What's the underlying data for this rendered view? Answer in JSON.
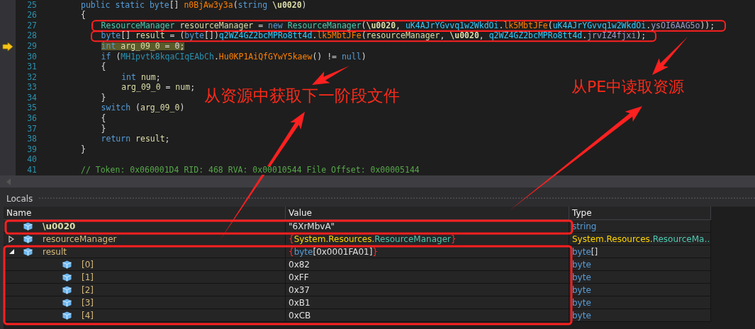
{
  "code_lines": [
    {
      "number": "25",
      "current": false,
      "tokens": [
        {
          "text": "public static byte",
          "kind": "keyword"
        },
        {
          "text": "[] ",
          "kind": "plain"
        },
        {
          "text": "n0BjAw3y3a",
          "kind": "method"
        },
        {
          "text": "(",
          "kind": "plain"
        },
        {
          "text": "string ",
          "kind": "keyword"
        },
        {
          "text": "\\u0020",
          "kind": "param"
        },
        {
          "text": ")",
          "kind": "plain"
        }
      ]
    },
    {
      "number": "26",
      "current": false,
      "tokens": [
        {
          "text": "{",
          "kind": "plain"
        }
      ],
      "children": [
        {
          "number": "27",
          "current": false,
          "tokens": [
            {
              "text": "ResourceManager ",
              "kind": "type"
            },
            {
              "text": "resourceManager",
              "kind": "local"
            },
            {
              "text": " = ",
              "kind": "plain"
            },
            {
              "text": "new ",
              "kind": "keyword"
            },
            {
              "text": "ResourceManager",
              "kind": "type"
            },
            {
              "text": "(",
              "kind": "plain"
            },
            {
              "text": "\\u0020",
              "kind": "param"
            },
            {
              "text": ", ",
              "kind": "plain"
            },
            {
              "text": "uK4AJrYGvvq1w2WkdOi",
              "kind": "class"
            },
            {
              "text": ".",
              "kind": "plain"
            },
            {
              "text": "lk5MbtJFe",
              "kind": "method"
            },
            {
              "text": "(",
              "kind": "plain"
            },
            {
              "text": "uK4AJrYGvvq1w2WkdOi",
              "kind": "class"
            },
            {
              "text": ".",
              "kind": "plain"
            },
            {
              "text": "ysOI6AAG5o",
              "kind": "field"
            },
            {
              "text": "));",
              "kind": "plain"
            }
          ]
        },
        {
          "number": "28",
          "current": false,
          "tokens": [
            {
              "text": "byte",
              "kind": "keyword"
            },
            {
              "text": "[] ",
              "kind": "plain"
            },
            {
              "text": "result",
              "kind": "local"
            },
            {
              "text": " = (",
              "kind": "plain"
            },
            {
              "text": "byte",
              "kind": "keyword"
            },
            {
              "text": "[])",
              "kind": "plain"
            },
            {
              "text": "q2WZ4GZ2bcMPRo8tt4d",
              "kind": "class"
            },
            {
              "text": ".",
              "kind": "plain"
            },
            {
              "text": "lk5MbtJFe",
              "kind": "method"
            },
            {
              "text": "(",
              "kind": "plain"
            },
            {
              "text": "resourceManager",
              "kind": "local"
            },
            {
              "text": ", ",
              "kind": "plain"
            },
            {
              "text": "\\u0020",
              "kind": "param"
            },
            {
              "text": ", ",
              "kind": "plain"
            },
            {
              "text": "q2WZ4GZ2bcMPRo8tt4d",
              "kind": "class"
            },
            {
              "text": ".",
              "kind": "plain"
            },
            {
              "text": "jrvIZ4fjxi",
              "kind": "field"
            },
            {
              "text": ");",
              "kind": "plain"
            }
          ]
        },
        {
          "number": "29",
          "current": true,
          "tokens": [
            {
              "text": "int ",
              "kind": "keyword"
            },
            {
              "text": "arg_09_0",
              "kind": "local"
            },
            {
              "text": " = 0;",
              "kind": "plain"
            }
          ]
        },
        {
          "number": "30",
          "current": false,
          "tokens": [
            {
              "text": "if",
              "kind": "keyword"
            },
            {
              "text": " (",
              "kind": "plain"
            },
            {
              "text": "MH1pvtk8kqaCIqEAbCh",
              "kind": "class2"
            },
            {
              "text": ".",
              "kind": "plain"
            },
            {
              "text": "Hu0KP1AiQfGYwY5kaew",
              "kind": "method"
            },
            {
              "text": "() != ",
              "kind": "plain"
            },
            {
              "text": "null",
              "kind": "keyword"
            },
            {
              "text": ")",
              "kind": "plain"
            }
          ]
        },
        {
          "number": "31",
          "current": false,
          "tokens": [
            {
              "text": "{",
              "kind": "plain"
            }
          ],
          "children": [
            {
              "number": "32",
              "current": false,
              "tokens": [
                {
                  "text": "int ",
                  "kind": "keyword"
                },
                {
                  "text": "num",
                  "kind": "local"
                },
                {
                  "text": ";",
                  "kind": "plain"
                }
              ]
            },
            {
              "number": "33",
              "current": false,
              "tokens": [
                {
                  "text": "arg_09_0",
                  "kind": "local"
                },
                {
                  "text": " = ",
                  "kind": "plain"
                },
                {
                  "text": "num",
                  "kind": "local"
                },
                {
                  "text": ";",
                  "kind": "plain"
                }
              ]
            }
          ]
        },
        {
          "number": "34",
          "current": false,
          "tokens": [
            {
              "text": "}",
              "kind": "plain"
            }
          ]
        },
        {
          "number": "35",
          "current": false,
          "tokens": [
            {
              "text": "switch",
              "kind": "keyword"
            },
            {
              "text": " (",
              "kind": "plain"
            },
            {
              "text": "arg_09_0",
              "kind": "local"
            },
            {
              "text": ")",
              "kind": "plain"
            }
          ]
        },
        {
          "number": "36",
          "current": false,
          "tokens": [
            {
              "text": "{",
              "kind": "plain"
            }
          ]
        },
        {
          "number": "37",
          "current": false,
          "tokens": [
            {
              "text": "}",
              "kind": "plain"
            }
          ]
        },
        {
          "number": "38",
          "current": false,
          "tokens": [
            {
              "text": "return ",
              "kind": "keyword"
            },
            {
              "text": "result",
              "kind": "local"
            },
            {
              "text": ";",
              "kind": "plain"
            }
          ]
        }
      ]
    },
    {
      "number": "39",
      "current": false,
      "tokens": [
        {
          "text": "}",
          "kind": "plain"
        }
      ]
    },
    {
      "number": "40",
      "current": false
    },
    {
      "number": "41",
      "current": false,
      "tokens": [
        {
          "text": "// Token: 0x060001D4 RID: 468 RVA: 0x00010544 File Offset: 0x00005144",
          "kind": "comment"
        }
      ]
    }
  ],
  "locals": {
    "title": "Locals",
    "columns": [
      "Name",
      "Value",
      "Type"
    ],
    "rows": [
      {
        "name": "\\u0020",
        "param": true,
        "value": [
          {
            "text": "\"6XrMbvA\"",
            "kind": "plain"
          }
        ],
        "type": [
          {
            "text": "string",
            "kind": "keyword"
          }
        ]
      },
      {
        "name": "resourceManager",
        "param": false,
        "expanded": false,
        "value": [
          {
            "text": "{",
            "kind": "brace"
          },
          {
            "text": "System.Resources.",
            "kind": "namespace"
          },
          {
            "text": "ResourceManager",
            "kind": "type"
          },
          {
            "text": "}",
            "kind": "brace"
          }
        ],
        "type": [
          {
            "text": "System.Resources.",
            "kind": "namespace"
          },
          {
            "text": "ResourceMa…",
            "kind": "type"
          }
        ]
      },
      {
        "name": "result",
        "param": false,
        "expanded": true,
        "value": [
          {
            "text": "{",
            "kind": "brace"
          },
          {
            "text": "byte",
            "kind": "keyword"
          },
          {
            "text": "[0x0001FA01]",
            "kind": "plain"
          },
          {
            "text": "}",
            "kind": "brace"
          }
        ],
        "type": [
          {
            "text": "byte",
            "kind": "keyword"
          },
          {
            "text": "[]",
            "kind": "plain"
          }
        ],
        "children": [
          {
            "name": "[0]",
            "param": false,
            "value": [
              {
                "text": "0x82",
                "kind": "plain"
              }
            ],
            "type": [
              {
                "text": "byte",
                "kind": "keyword"
              }
            ]
          },
          {
            "name": "[1]",
            "param": false,
            "value": [
              {
                "text": "0xFF",
                "kind": "plain"
              }
            ],
            "type": [
              {
                "text": "byte",
                "kind": "keyword"
              }
            ]
          },
          {
            "name": "[2]",
            "param": false,
            "value": [
              {
                "text": "0x37",
                "kind": "plain"
              }
            ],
            "type": [
              {
                "text": "byte",
                "kind": "keyword"
              }
            ]
          },
          {
            "name": "[3]",
            "param": false,
            "value": [
              {
                "text": "0xB1",
                "kind": "plain"
              }
            ],
            "type": [
              {
                "text": "byte",
                "kind": "keyword"
              }
            ]
          },
          {
            "name": "[4]",
            "param": false,
            "value": [
              {
                "text": "0xCB",
                "kind": "plain"
              }
            ],
            "type": [
              {
                "text": "byte",
                "kind": "keyword"
              }
            ]
          }
        ]
      }
    ]
  },
  "annotations": [
    {
      "text": "从资源中获取下一阶段文件"
    },
    {
      "text": "从PE中读取资源"
    }
  ]
}
